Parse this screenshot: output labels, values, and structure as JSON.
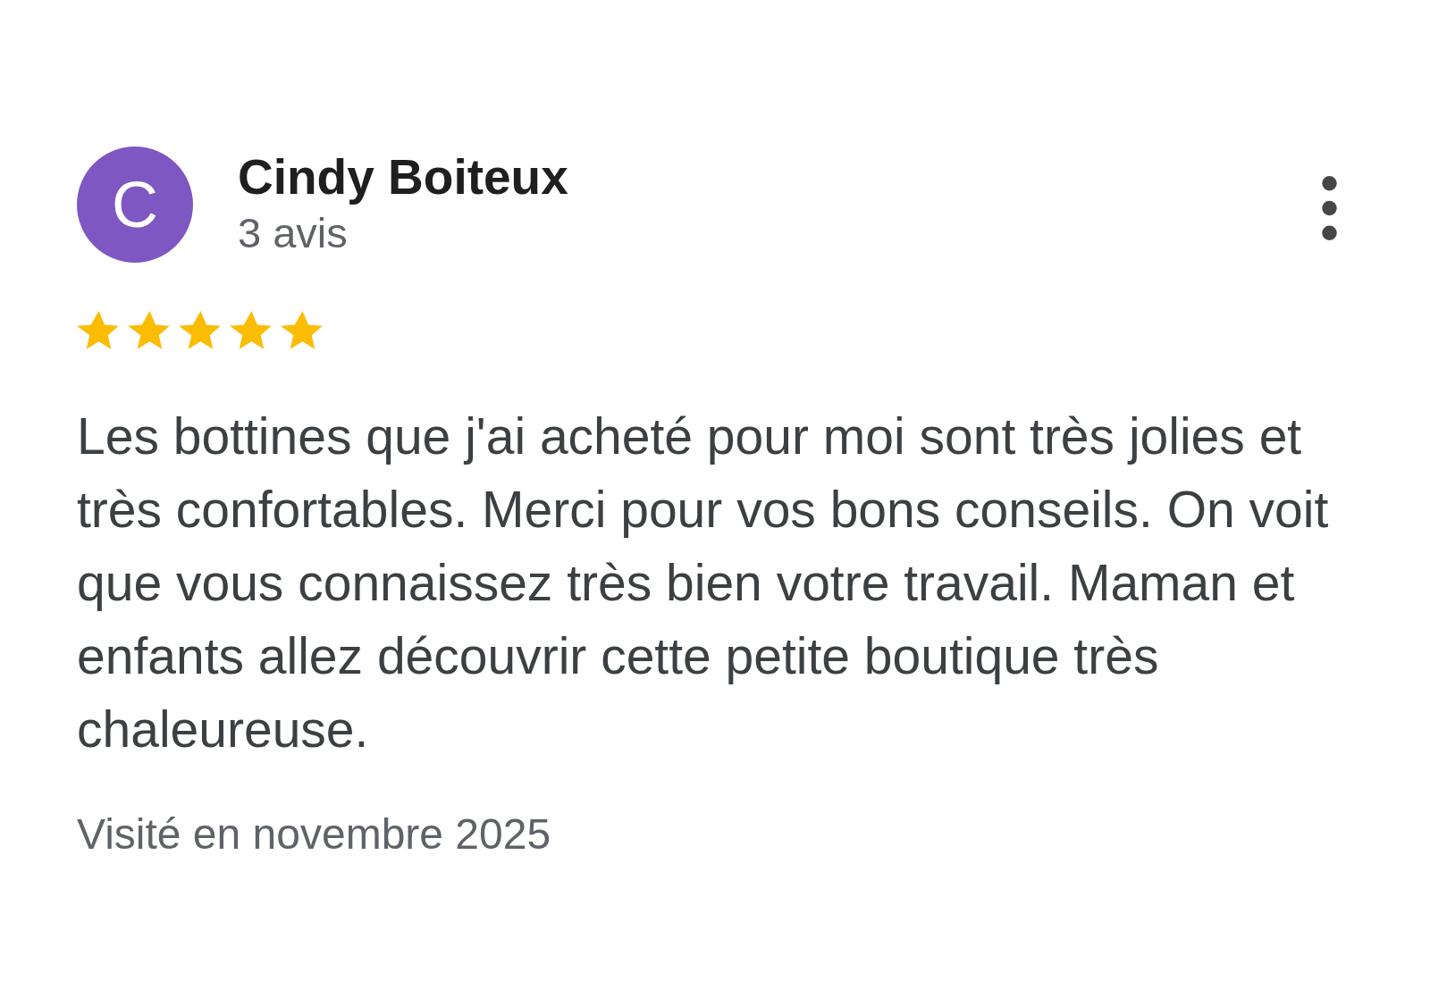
{
  "review": {
    "avatar": {
      "initial": "C"
    },
    "author": "Cindy Boiteux",
    "review_count": "3 avis",
    "stars": 5,
    "text": "Les bottines que j'ai acheté pour moi sont très jolies et très confortables. Merci pour vos bons conseils. On voit que vous connaissez très bien votre travail. Maman et enfants allez découvrir cette petite boutique très chaleureuse.",
    "visit": "Visité en novembre 2025"
  }
}
